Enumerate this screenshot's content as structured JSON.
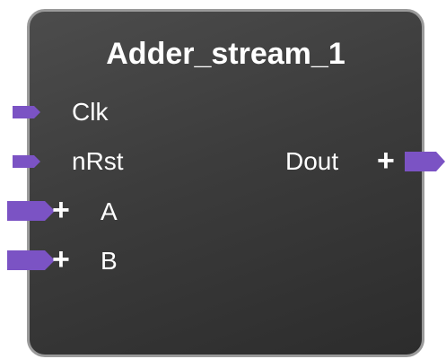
{
  "block": {
    "title": "Adder_stream_1",
    "pin_color": "#7b53c4",
    "inputs": [
      {
        "name": "Clk",
        "expandable": false
      },
      {
        "name": "nRst",
        "expandable": false
      },
      {
        "name": "A",
        "expandable": true,
        "expand_symbol": "+"
      },
      {
        "name": "B",
        "expandable": true,
        "expand_symbol": "+"
      }
    ],
    "outputs": [
      {
        "name": "Dout",
        "expandable": true,
        "expand_symbol": "+"
      }
    ]
  }
}
